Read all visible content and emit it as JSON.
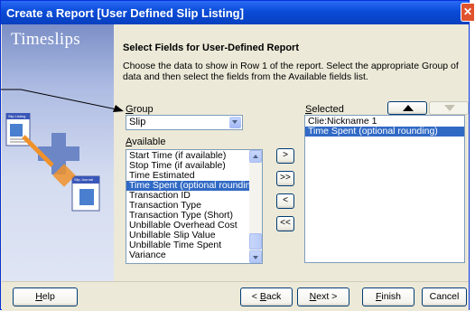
{
  "window": {
    "title": "Create a Report [User Defined Slip Listing]",
    "close_glyph": "✕"
  },
  "sidebar": {
    "logo_text": "Timeslips",
    "doc1_label": "Slip Listing",
    "doc2_label": "Slip Journal"
  },
  "page": {
    "heading": "Select Fields for User-Defined Report",
    "description": "Choose the data to show in Row 1 of the report. Select the appropriate Group of data and then select the fields from the Available fields list."
  },
  "group": {
    "label_first": "G",
    "label_rest": "roup",
    "value": "Slip"
  },
  "available": {
    "label_first": "A",
    "label_rest": "vailable",
    "items": [
      "Start Time (if available)",
      "Stop Time (if available)",
      "Time Estimated",
      "Time Spent (optional rounding)",
      "Transaction ID",
      "Transaction Type",
      "Transaction Type (Short)",
      "Unbillable Overhead Cost",
      "Unbillable Slip Value",
      "Unbillable Time Spent",
      "Variance"
    ],
    "selected_index": 3
  },
  "transfer": {
    "add": ">",
    "add_all": ">>",
    "remove": "<",
    "remove_all": "<<"
  },
  "selected": {
    "label_first": "S",
    "label_rest": "elected",
    "items": [
      "Clie:Nickname 1",
      "Time Spent (optional rounding)"
    ],
    "selected_index": 1
  },
  "buttons": {
    "help_first": "H",
    "help_rest": "elp",
    "back_prefix": "< ",
    "back_first": "B",
    "back_rest": "ack",
    "next_first": "N",
    "next_rest": "ext >",
    "finish_first": "F",
    "finish_rest": "inish",
    "cancel": "Cancel"
  },
  "colors": {
    "title_bar": "#0a4bd8",
    "selection": "#316ac5",
    "face": "#ece9d8"
  }
}
